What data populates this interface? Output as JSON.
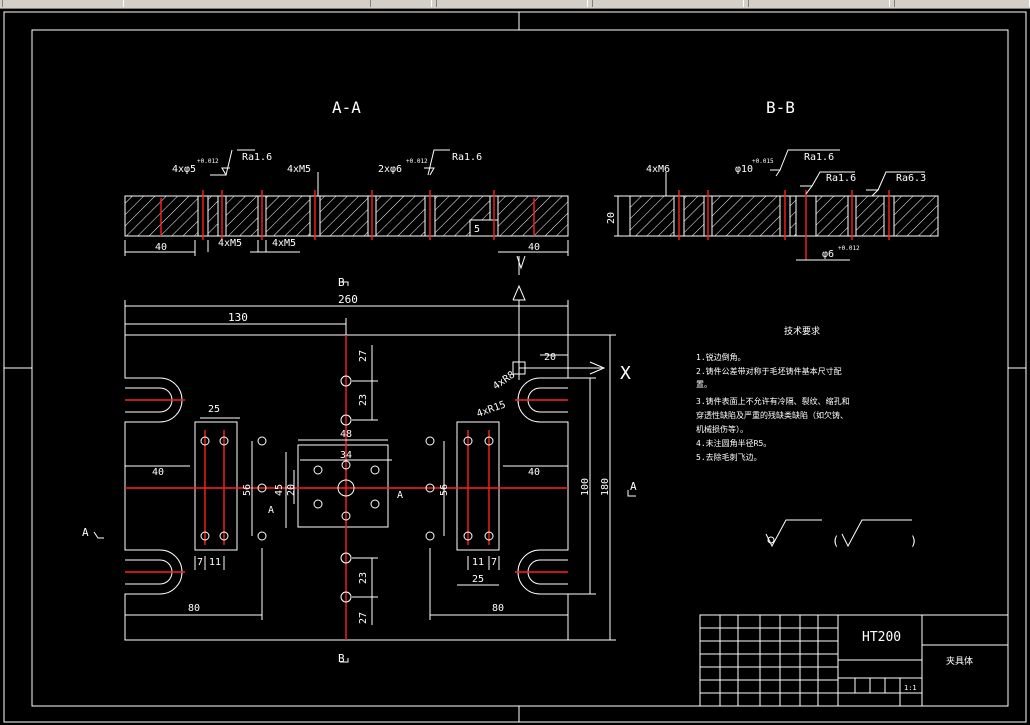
{
  "window": {
    "toolbar": "cad-toolbar"
  },
  "colors": {
    "background": "#000000",
    "line": "#ffffff",
    "center": "#ff2020",
    "hatch": "#ffffff"
  },
  "sections": {
    "aa_title": "A-A",
    "bb_title": "B-B"
  },
  "aa_annotations": {
    "hole_phi_a": "4xφ5",
    "hole_phi_a_tol": "+0.012",
    "hole_phi_a_tol2": "0",
    "ra_a": "Ra1.6",
    "thread_a": "4xM5",
    "hole_phi_b": "2xφ6",
    "hole_phi_b_tol": "+0.012",
    "hole_phi_b_tol2": "0",
    "ra_b": "Ra1.6",
    "dim_left": "40",
    "m5_left": "4xM5",
    "m5_right": "4xM5",
    "dim_5": "5",
    "dim_right": "40"
  },
  "bb_annotations": {
    "thread": "4xM6",
    "hole_phi": "φ10",
    "hole_phi_tol": "+0.015",
    "hole_phi_tol2": "0",
    "ra_1": "Ra1.6",
    "ra_2": "Ra1.6",
    "ra_3": "Ra6.3",
    "thickness": "20",
    "hole_bottom": "φ6",
    "hole_bottom_tol": "+0.012",
    "hole_bottom_tol2": "0"
  },
  "plan_dims": {
    "section_b_top": "B",
    "total": "260",
    "half": "130",
    "d27_top": "27",
    "d23_top": "23",
    "d20": "20",
    "d25_left": "25",
    "d48": "48",
    "d34": "34",
    "d40_left": "40",
    "d56_left": "56",
    "d45": "45",
    "d20b": "20",
    "d56_right": "56",
    "d100": "100",
    "d180": "180",
    "d40_right": "40",
    "r4": "4xR8",
    "r15": "4xR15",
    "d7_left": "7",
    "d11_left": "11",
    "d23_bot": "23",
    "d27_bot": "27",
    "d11_right": "11",
    "d7_right": "7",
    "d25_right": "25",
    "d80_left": "80",
    "d80_right": "80",
    "section_b_bot": "B",
    "section_a_left": "A",
    "section_a_right": "A",
    "section_a_mid": "A",
    "section_a_mid2": "A",
    "axis_x": "X"
  },
  "tech_req": {
    "title": "技术要求",
    "items": [
      "1.锐边倒角。",
      "2.铸件公差带对称于毛坯铸件基本尺寸配",
      "置。",
      "3.铸件表面上不允许有冷隔、裂纹、缩孔和",
      "穿透性缺陷及严重的残缺类缺陷（如欠铸、",
      "机械损伤等）。",
      "4.未注圆角半径R5。",
      "5.去除毛刺飞边。"
    ],
    "rough_open": "(",
    "rough_close": ")"
  },
  "title_block": {
    "material": "HT200",
    "part_name": "夹具体",
    "scale": "1:1"
  }
}
